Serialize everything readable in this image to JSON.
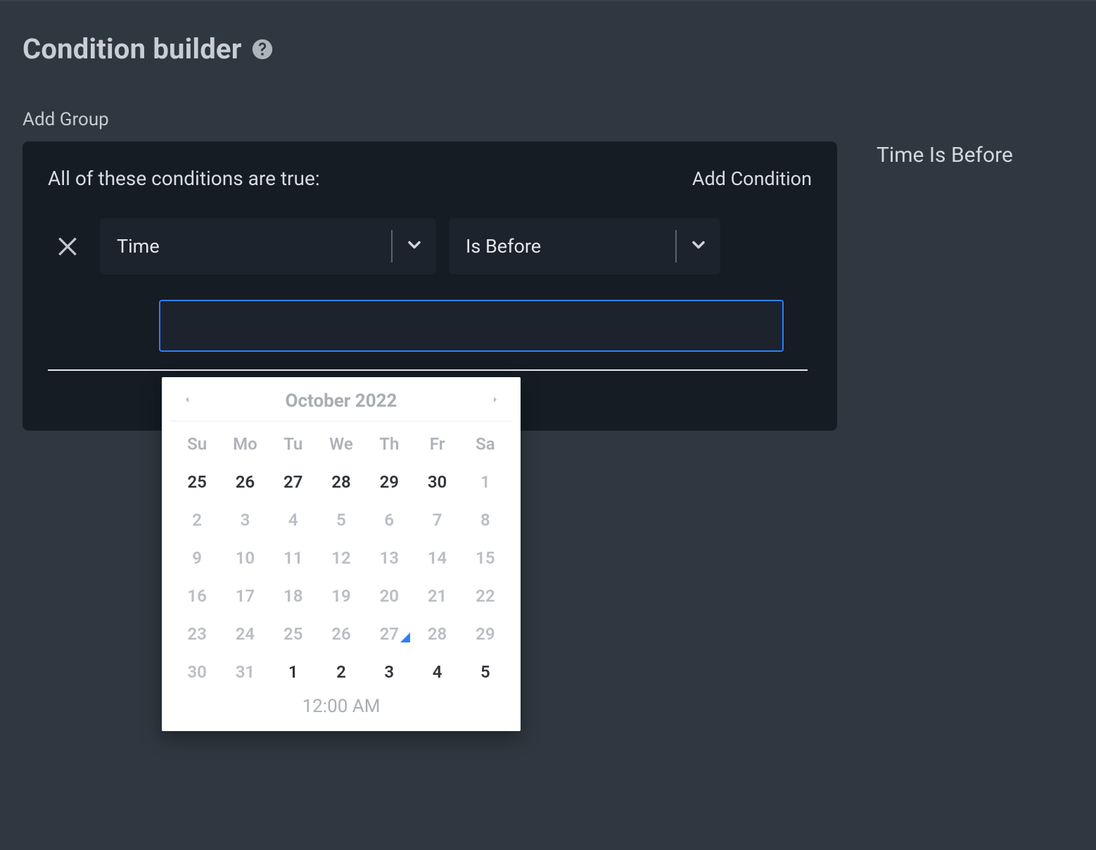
{
  "header": {
    "title": "Condition builder"
  },
  "actions": {
    "add_group": "Add Group"
  },
  "side": {
    "summary": "Time Is Before"
  },
  "panel": {
    "heading": "All of these conditions are true:",
    "add_condition": "Add Condition",
    "condition": {
      "variable_label": "Time",
      "operator_label": "Is Before",
      "value": ""
    }
  },
  "calendar": {
    "month_label": "October 2022",
    "weekdays": [
      "Su",
      "Mo",
      "Tu",
      "We",
      "Th",
      "Fr",
      "Sa"
    ],
    "today_index": 32,
    "time_label": "12:00 AM",
    "days": [
      {
        "n": "25",
        "kind": "dark"
      },
      {
        "n": "26",
        "kind": "dark"
      },
      {
        "n": "27",
        "kind": "dark"
      },
      {
        "n": "28",
        "kind": "dark"
      },
      {
        "n": "29",
        "kind": "dark"
      },
      {
        "n": "30",
        "kind": "dark"
      },
      {
        "n": "1",
        "kind": "in"
      },
      {
        "n": "2",
        "kind": "in"
      },
      {
        "n": "3",
        "kind": "in"
      },
      {
        "n": "4",
        "kind": "in"
      },
      {
        "n": "5",
        "kind": "in"
      },
      {
        "n": "6",
        "kind": "in"
      },
      {
        "n": "7",
        "kind": "in"
      },
      {
        "n": "8",
        "kind": "in"
      },
      {
        "n": "9",
        "kind": "in"
      },
      {
        "n": "10",
        "kind": "in"
      },
      {
        "n": "11",
        "kind": "in"
      },
      {
        "n": "12",
        "kind": "in"
      },
      {
        "n": "13",
        "kind": "in"
      },
      {
        "n": "14",
        "kind": "in"
      },
      {
        "n": "15",
        "kind": "in"
      },
      {
        "n": "16",
        "kind": "in"
      },
      {
        "n": "17",
        "kind": "in"
      },
      {
        "n": "18",
        "kind": "in"
      },
      {
        "n": "19",
        "kind": "in"
      },
      {
        "n": "20",
        "kind": "in"
      },
      {
        "n": "21",
        "kind": "in"
      },
      {
        "n": "22",
        "kind": "in"
      },
      {
        "n": "23",
        "kind": "in"
      },
      {
        "n": "24",
        "kind": "in"
      },
      {
        "n": "25",
        "kind": "in"
      },
      {
        "n": "26",
        "kind": "in"
      },
      {
        "n": "27",
        "kind": "in"
      },
      {
        "n": "28",
        "kind": "in"
      },
      {
        "n": "29",
        "kind": "in"
      },
      {
        "n": "30",
        "kind": "in"
      },
      {
        "n": "31",
        "kind": "in"
      },
      {
        "n": "1",
        "kind": "dark"
      },
      {
        "n": "2",
        "kind": "dark"
      },
      {
        "n": "3",
        "kind": "dark"
      },
      {
        "n": "4",
        "kind": "dark"
      },
      {
        "n": "5",
        "kind": "dark"
      }
    ]
  }
}
